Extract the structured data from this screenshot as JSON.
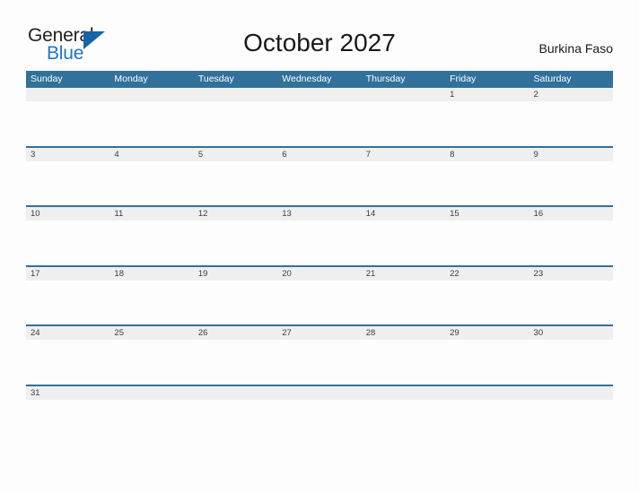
{
  "logo": {
    "word_one": "General",
    "word_two": "Blue",
    "flag_icon": "triangle-flag-icon",
    "accent_color": "#1f76c4"
  },
  "header": {
    "title": "October 2027",
    "country": "Burkina Faso"
  },
  "theme": {
    "header_blue": "#31719b",
    "row_band_gray": "#efefef",
    "page_background": "#fdfdfd"
  },
  "calendar": {
    "day_headers": [
      "Sunday",
      "Monday",
      "Tuesday",
      "Wednesday",
      "Thursday",
      "Friday",
      "Saturday"
    ],
    "weeks": [
      [
        "",
        "",
        "",
        "",
        "",
        "1",
        "2"
      ],
      [
        "3",
        "4",
        "5",
        "6",
        "7",
        "8",
        "9"
      ],
      [
        "10",
        "11",
        "12",
        "13",
        "14",
        "15",
        "16"
      ],
      [
        "17",
        "18",
        "19",
        "20",
        "21",
        "22",
        "23"
      ],
      [
        "24",
        "25",
        "26",
        "27",
        "28",
        "29",
        "30"
      ],
      [
        "31",
        "",
        "",
        "",
        "",
        "",
        ""
      ]
    ]
  }
}
